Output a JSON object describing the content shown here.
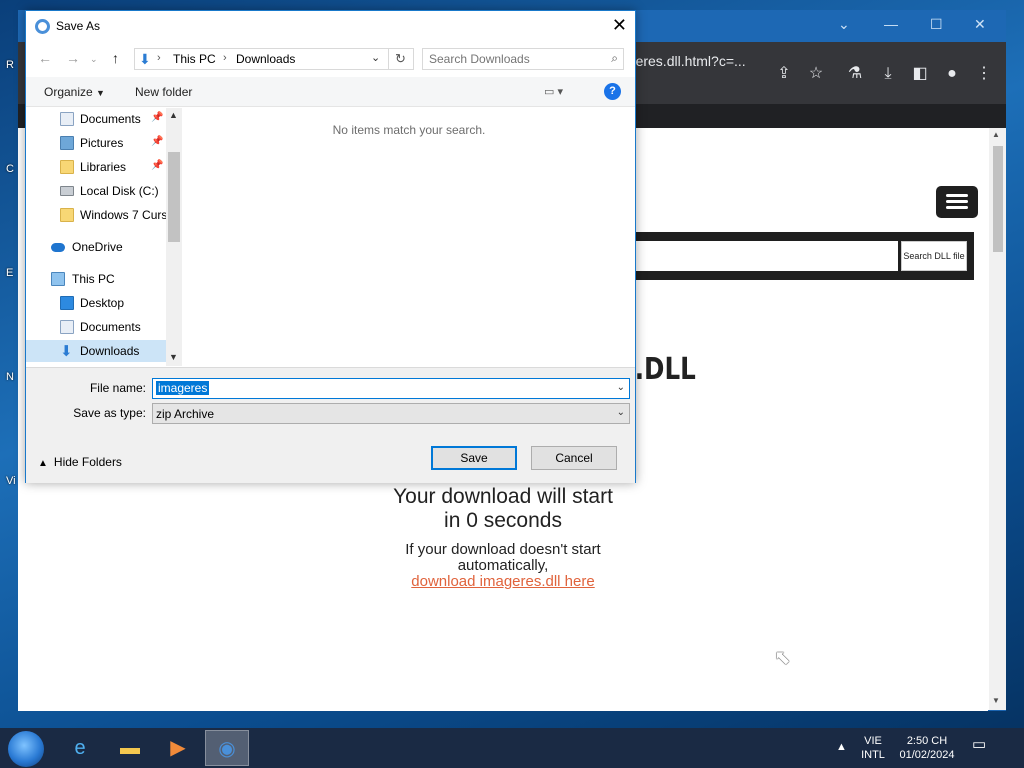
{
  "desktop": {
    "labels": [
      "R",
      "C",
      "E",
      "N",
      "Vi"
    ]
  },
  "browser": {
    "url_fragment": "ageres.dll.html?c=...",
    "page": {
      "search_button": "Search DLL file",
      "heading_partial": "S.DLL",
      "download_title_line1": "Your download will start",
      "download_title_line2": "in 0 seconds",
      "download_sub_line1": "If your download doesn't start",
      "download_sub_line2": "automatically,",
      "download_link": "download imageres.dll here"
    },
    "icons": [
      "share-icon",
      "star-icon",
      "labs-icon",
      "download-icon",
      "sidepanel-icon",
      "profile-icon",
      "menu-icon"
    ]
  },
  "dialog": {
    "title": "Save As",
    "breadcrumb": [
      "This PC",
      "Downloads"
    ],
    "search_placeholder": "Search Downloads",
    "organize_label": "Organize",
    "new_folder_label": "New folder",
    "help_label": "?",
    "empty_message": "No items match your search.",
    "nav_items": [
      {
        "label": "Documents",
        "icon": "documents-icon",
        "pinned": true
      },
      {
        "label": "Pictures",
        "icon": "pictures-icon",
        "pinned": true
      },
      {
        "label": "Libraries",
        "icon": "folder-icon",
        "pinned": true
      },
      {
        "label": "Local Disk (C:)",
        "icon": "drive-icon",
        "pinned": false
      },
      {
        "label": "Windows 7 Curs",
        "icon": "folder-icon",
        "pinned": false
      },
      {
        "label": "OneDrive",
        "icon": "onedrive-icon",
        "pinned": false
      },
      {
        "label": "This PC",
        "icon": "computer-icon",
        "pinned": false
      },
      {
        "label": "Desktop",
        "icon": "desktop-icon",
        "pinned": false
      },
      {
        "label": "Documents",
        "icon": "documents-icon",
        "pinned": false
      },
      {
        "label": "Downloads",
        "icon": "downloads-icon",
        "pinned": false,
        "selected": true
      }
    ],
    "file_name_label": "File name:",
    "file_name_value": "imageres",
    "save_type_label": "Save as type:",
    "save_type_value": "zip Archive",
    "hide_folders_label": "Hide Folders",
    "save_button": "Save",
    "cancel_button": "Cancel"
  },
  "taskbar": {
    "apps": [
      "start-icon",
      "ie-icon",
      "explorer-icon",
      "media-icon",
      "chrome-icon"
    ],
    "lang_line1": "VIE",
    "lang_line2": "INTL",
    "time": "2:50 CH",
    "date": "01/02/2024"
  }
}
